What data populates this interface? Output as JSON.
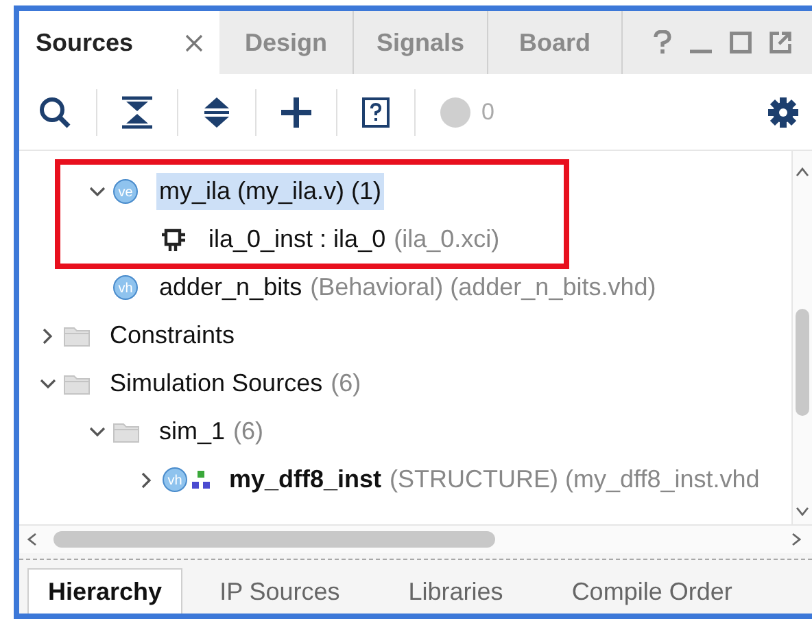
{
  "tabs": [
    {
      "label": "Sources",
      "selected": true,
      "closable": true
    },
    {
      "label": "Design",
      "selected": false,
      "closable": false
    },
    {
      "label": "Signals",
      "selected": false,
      "closable": false
    },
    {
      "label": "Board",
      "selected": false,
      "closable": false
    }
  ],
  "toolbar": {
    "message_count": "0"
  },
  "tree_continued": [
    {
      "name": "my_ila (my_ila.v) (1)",
      "kind": "hdl",
      "icon_label": "ve",
      "selected": true,
      "expanded": true,
      "annotated": true,
      "children": [
        {
          "name": "ila_0_inst : ila_0",
          "detail": "(ila_0.xci)",
          "kind": "ip",
          "selected": false
        }
      ]
    },
    {
      "name": "adder_n_bits",
      "detail": "(Behavioral) (adder_n_bits.vhd)",
      "kind": "hdl",
      "icon_label": "vh",
      "selected": false,
      "annotated": false
    }
  ],
  "tree": [
    {
      "name": "Constraints",
      "kind": "folder",
      "selected": false,
      "expanded": false
    },
    {
      "name": "Simulation Sources",
      "detail": "(6)",
      "kind": "folder",
      "selected": false,
      "expanded": true,
      "children": [
        {
          "name": "sim_1",
          "detail": "(6)",
          "kind": "folder",
          "selected": false,
          "expanded": true,
          "children": [
            {
              "name": "my_dff8_inst",
              "detail": "(STRUCTURE) (my_dff8_inst.vhd",
              "kind": "vhdl_top",
              "icon_label": "vh",
              "selected": false,
              "expanded": false
            }
          ]
        }
      ]
    }
  ],
  "bottom_tabs": [
    {
      "label": "Hierarchy",
      "selected": true
    },
    {
      "label": "IP Sources",
      "selected": false
    },
    {
      "label": "Libraries",
      "selected": false
    },
    {
      "label": "Compile Order",
      "selected": false
    }
  ]
}
